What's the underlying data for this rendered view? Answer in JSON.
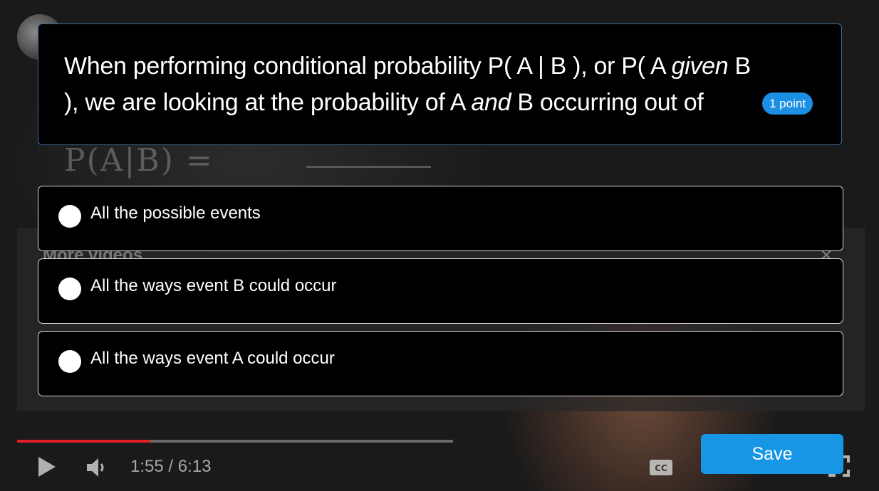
{
  "quiz": {
    "question": "When performing conditional probability P( A | B ), or P( A given B ), we are looking at the probability of A and B occurring out of",
    "question_parts": {
      "p1": "When performing conditional probability P( A | B ), or P( A ",
      "given": "given",
      "p2": " B ), we are looking at the probability of A ",
      "and": "and",
      "p3": " B occurring out of"
    },
    "points": "1 point",
    "options": [
      {
        "label": "All the possible events",
        "selected": false
      },
      {
        "label": "All the ways event B could occur",
        "selected": false
      },
      {
        "label": "All the ways event A could occur",
        "selected": false
      }
    ],
    "save_label": "Save"
  },
  "player": {
    "time": "1:55 / 6:13",
    "progress_played": 0.305,
    "progress_loaded": 0.5,
    "more_videos": "More videos",
    "chalkboard": "P(A|B) ="
  },
  "colors": {
    "accent": "#1796e6",
    "card_border": "#3d6fa0",
    "progress": "#e3202a"
  },
  "icons": [
    "play-icon",
    "volume-icon",
    "cc-icon",
    "settings-icon",
    "fullscreen-icon",
    "close-icon",
    "radio-icon"
  ]
}
